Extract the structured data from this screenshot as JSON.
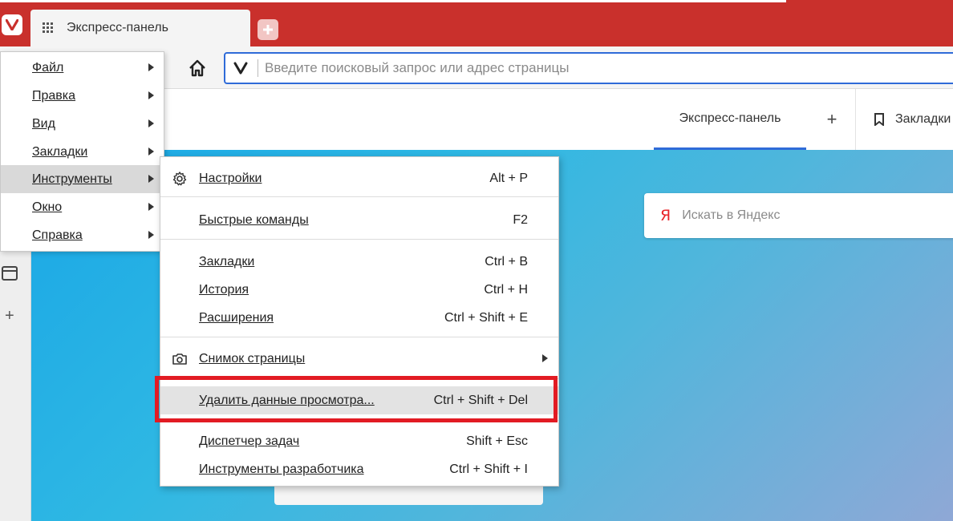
{
  "tab": {
    "title": "Экспресс-панель"
  },
  "address_bar": {
    "placeholder": "Введите поисковый запрос или адрес страницы"
  },
  "speed_dial": {
    "tab_label": "Экспресс-панель",
    "add_label": "+",
    "bookmarks_label": "Закладки"
  },
  "search": {
    "logo": "Я",
    "placeholder": "Искать в Яндекс"
  },
  "panel": {
    "add_label": "+"
  },
  "main_menu": {
    "items": [
      {
        "label": "Файл"
      },
      {
        "label": "Правка"
      },
      {
        "label": "Вид"
      },
      {
        "label": "Закладки"
      },
      {
        "label": "Инструменты"
      },
      {
        "label": "Окно"
      },
      {
        "label": "Справка"
      }
    ]
  },
  "tools_menu": {
    "items": [
      {
        "label": "Настройки",
        "shortcut": "Alt + P"
      },
      {
        "label": "Быстрые команды",
        "shortcut": "F2"
      },
      {
        "label": "Закладки",
        "shortcut": "Ctrl + B"
      },
      {
        "label": "История",
        "shortcut": "Ctrl + H"
      },
      {
        "label": "Расширения",
        "shortcut": "Ctrl + Shift + E"
      },
      {
        "label": "Снимок страницы",
        "shortcut": ""
      },
      {
        "label": "Удалить данные просмотра...",
        "shortcut": "Ctrl + Shift + Del"
      },
      {
        "label": "Диспетчер задач",
        "shortcut": "Shift + Esc"
      },
      {
        "label": "Инструменты разработчика",
        "shortcut": "Ctrl + Shift + I"
      }
    ]
  },
  "colors": {
    "brand_red": "#c9302c",
    "accent_blue": "#2f6bd8",
    "highlight_frame": "#e21b23"
  },
  "icons": {
    "app": "vivaldi-logo-icon",
    "tab": "grid-icon",
    "new_tab": "plus-icon",
    "home": "home-icon",
    "address": "vivaldi-v-icon",
    "bookmarks": "bookmark-icon",
    "settings": "gear-icon",
    "capture": "camera-icon",
    "panel": "window-icon"
  }
}
